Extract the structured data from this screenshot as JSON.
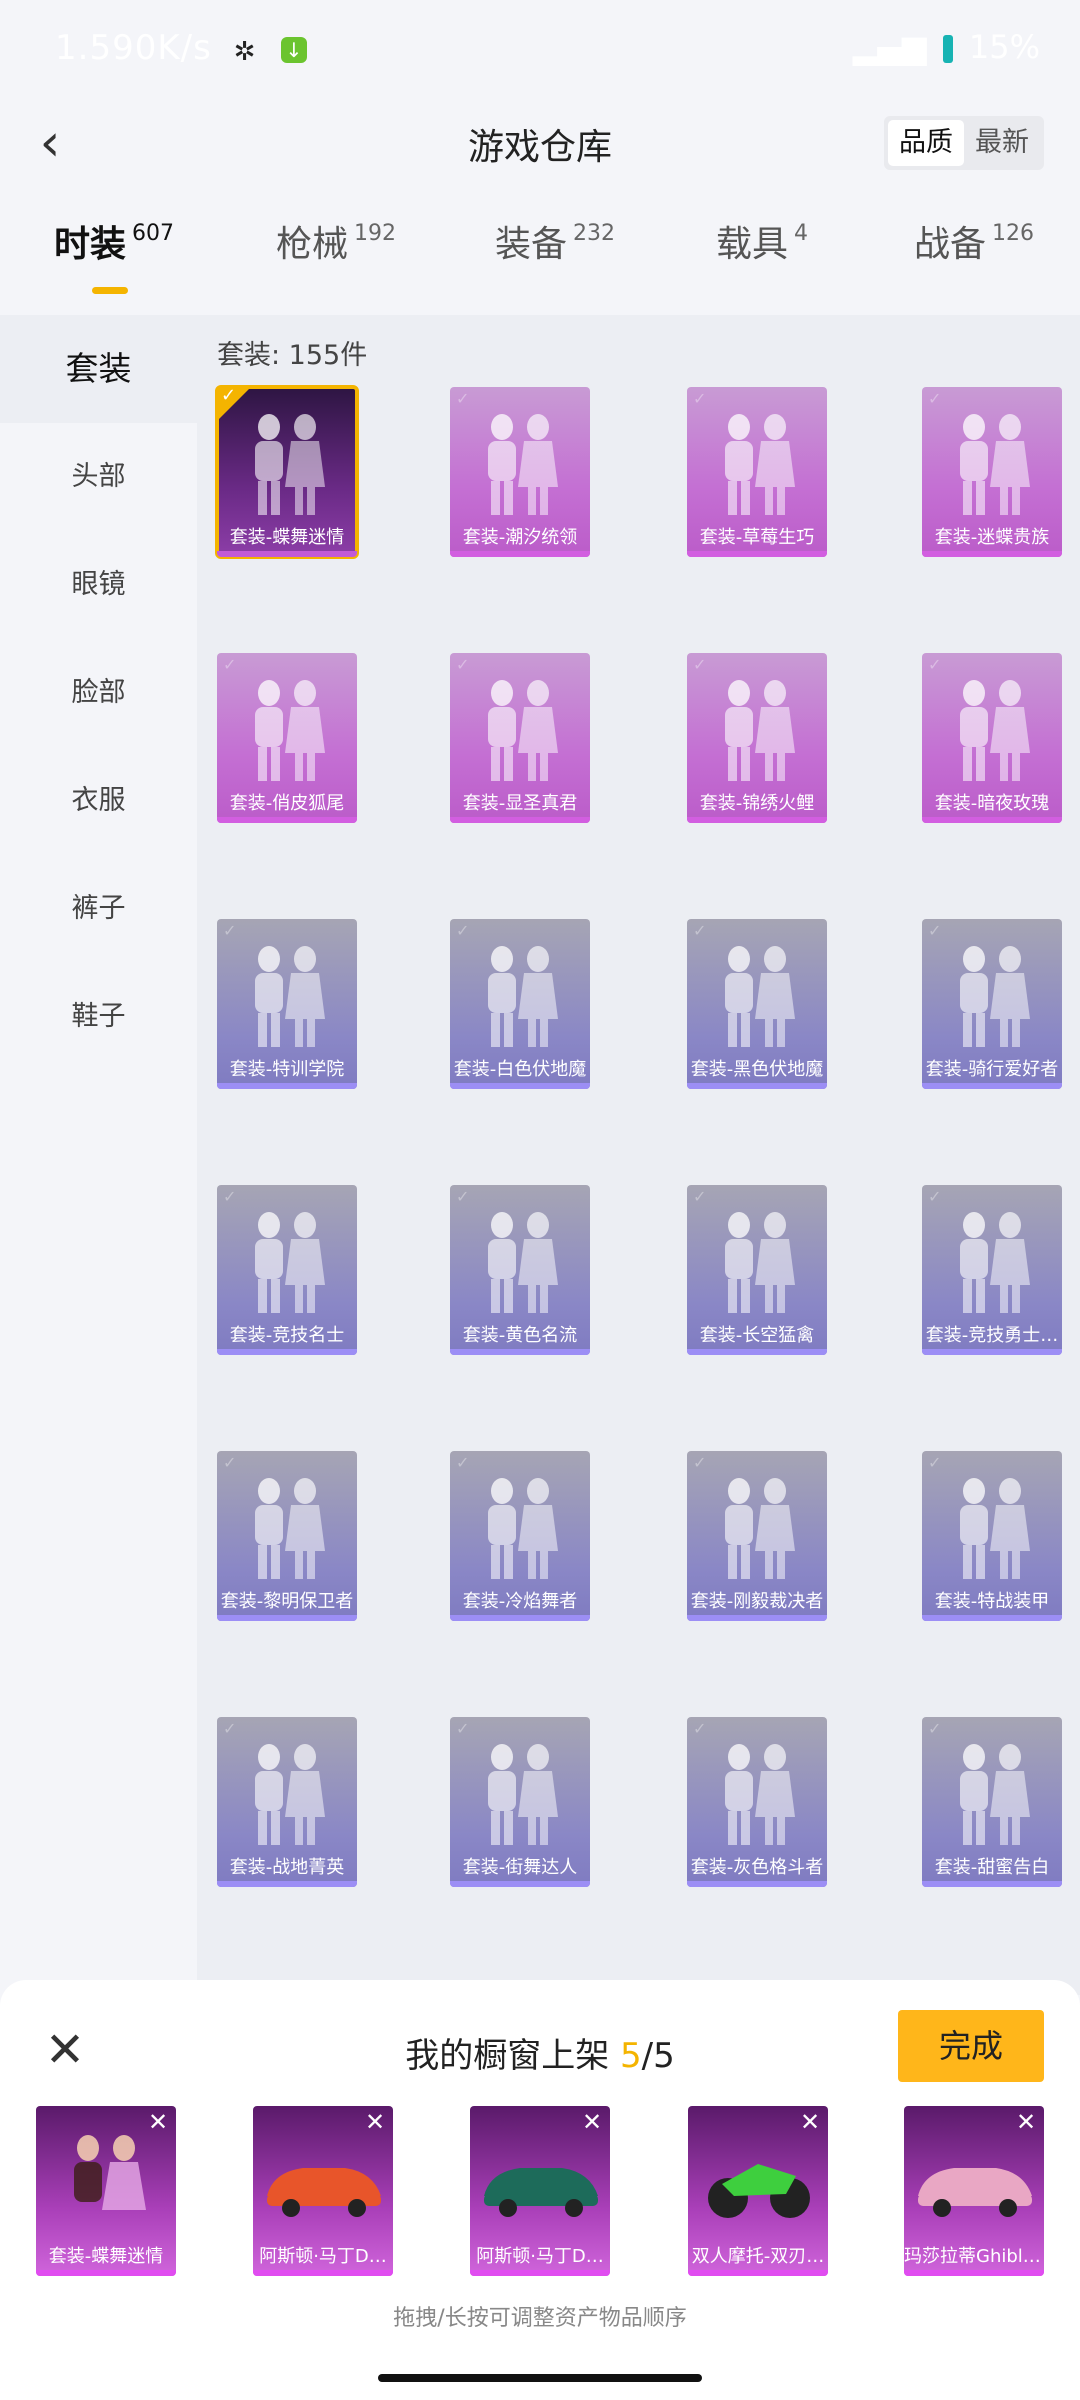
{
  "status_bar": {
    "left_text": "1.590K/s",
    "right_text": "15%"
  },
  "header": {
    "title": "游戏仓库",
    "sort_options": [
      "品质",
      "最新"
    ]
  },
  "categories": [
    {
      "label": "时装",
      "count": "607"
    },
    {
      "label": "枪械",
      "count": "192"
    },
    {
      "label": "装备",
      "count": "232"
    },
    {
      "label": "载具",
      "count": "4"
    },
    {
      "label": "战备",
      "count": "126"
    }
  ],
  "sidebar": [
    "套装",
    "头部",
    "眼镜",
    "脸部",
    "衣服",
    "裤子",
    "鞋子"
  ],
  "content": {
    "count_label": "套装: 155件",
    "items": [
      {
        "name": "套装-蝶舞迷情",
        "rarity": "legendary",
        "selected": true
      },
      {
        "name": "套装-潮汐统领",
        "rarity": "epic"
      },
      {
        "name": "套装-草莓生巧",
        "rarity": "epic"
      },
      {
        "name": "套装-迷蝶贵族",
        "rarity": "epic"
      },
      {
        "name": "套装-俏皮狐尾",
        "rarity": "epic"
      },
      {
        "name": "套装-显圣真君",
        "rarity": "epic"
      },
      {
        "name": "套装-锦绣火鲤",
        "rarity": "epic"
      },
      {
        "name": "套装-暗夜玫瑰",
        "rarity": "epic"
      },
      {
        "name": "套装-特训学院",
        "rarity": "rare"
      },
      {
        "name": "套装-白色伏地魔",
        "rarity": "rare"
      },
      {
        "name": "套装-黑色伏地魔",
        "rarity": "rare"
      },
      {
        "name": "套装-骑行爱好者",
        "rarity": "rare"
      },
      {
        "name": "套装-竞技名士",
        "rarity": "rare"
      },
      {
        "name": "套装-黄色名流",
        "rarity": "rare"
      },
      {
        "name": "套装-长空猛禽",
        "rarity": "rare"
      },
      {
        "name": "套装-竞技勇士…",
        "rarity": "rare"
      },
      {
        "name": "套装-黎明保卫者",
        "rarity": "rare"
      },
      {
        "name": "套装-冷焰舞者",
        "rarity": "rare"
      },
      {
        "name": "套装-刚毅裁决者",
        "rarity": "rare"
      },
      {
        "name": "套装-特战装甲",
        "rarity": "rare"
      },
      {
        "name": "套装-战地菁英",
        "rarity": "rare"
      },
      {
        "name": "套装-街舞达人",
        "rarity": "rare"
      },
      {
        "name": "套装-灰色格斗者",
        "rarity": "rare"
      },
      {
        "name": "套装-甜蜜告白",
        "rarity": "rare"
      }
    ]
  },
  "shelf": {
    "title_prefix": "我的橱窗上架 ",
    "current": "5",
    "sep_total": "/5",
    "done_label": "完成",
    "items": [
      {
        "name": "套装-蝶舞迷情",
        "kind": "outfit"
      },
      {
        "name": "阿斯顿·马丁D…",
        "kind": "car-orange"
      },
      {
        "name": "阿斯顿·马丁D…",
        "kind": "car-green"
      },
      {
        "name": "双人摩托-双刃…",
        "kind": "moto"
      },
      {
        "name": "玛莎拉蒂Ghibli…",
        "kind": "car-pink"
      }
    ],
    "hint": "拖拽/长按可调整资产物品顺序"
  },
  "colors": {
    "accent": "#f4b400",
    "done_button": "#ffb61a",
    "epic": "#c46fd3",
    "rare": "#8a87c6"
  }
}
